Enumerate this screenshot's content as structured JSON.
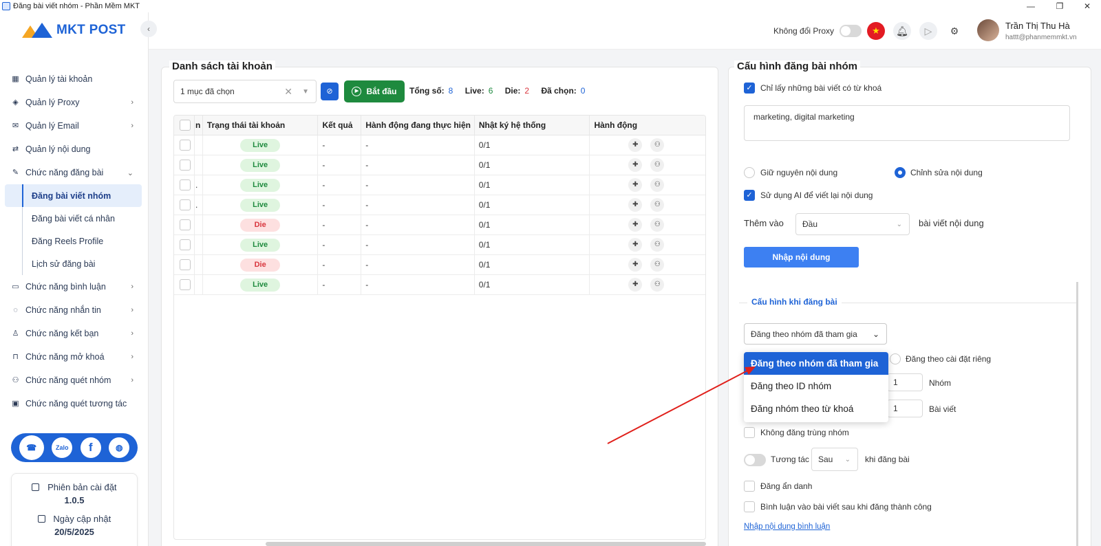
{
  "window": {
    "title": "Đăng bài viết nhóm - Phần Mềm MKT"
  },
  "brand": {
    "logo_text": "MKT POST"
  },
  "sidebar": {
    "items": [
      {
        "label": "Quản lý tài khoản",
        "icon": "grid-icon",
        "has_children": false
      },
      {
        "label": "Quản lý Proxy",
        "icon": "layers-icon",
        "has_children": true
      },
      {
        "label": "Quản lý Email",
        "icon": "mail-icon",
        "has_children": true
      },
      {
        "label": "Quản lý nội dung",
        "icon": "share-icon",
        "has_children": false
      },
      {
        "label": "Chức năng đăng bài",
        "icon": "edit-icon",
        "has_children": true,
        "expanded": true
      }
    ],
    "sub_items": [
      "Đăng bài viết nhóm",
      "Đăng bài viết cá nhân",
      "Đăng Reels Profile",
      "Lịch sử đăng bài"
    ],
    "items_after": [
      {
        "label": "Chức năng bình luận",
        "icon": "comment-icon"
      },
      {
        "label": "Chức năng nhắn tin",
        "icon": "chat-icon"
      },
      {
        "label": "Chức năng kết bạn",
        "icon": "user-plus-icon"
      },
      {
        "label": "Chức năng mở khoá",
        "icon": "lock-icon"
      },
      {
        "label": "Chức năng quét nhóm",
        "icon": "group-icon"
      },
      {
        "label": "Chức năng quét tương tác",
        "icon": "scan-icon",
        "no_chevron": true
      }
    ],
    "social": [
      "support-icon",
      "zalo-icon",
      "facebook-icon",
      "globe-icon"
    ],
    "social_zalo_text": "Zalo",
    "version_label": "Phiên bản cài đặt",
    "version_value": "1.0.5",
    "update_label": "Ngày cập nhật",
    "update_value": "20/5/2025"
  },
  "topbar": {
    "proxy_label": "Không đổi Proxy",
    "user_name": "Trần Thị Thu Hà",
    "user_email": "hattt@phanmemmkt.vn"
  },
  "accounts": {
    "title": "Danh sách tài khoản",
    "select_value": "1 mục đã chọn",
    "start_label": "Bắt đầu",
    "stats": {
      "total_label": "Tổng số:",
      "total": "8",
      "live_label": "Live:",
      "live": "6",
      "die_label": "Die:",
      "die": "2",
      "selected_label": "Đã chọn:",
      "selected": "0"
    },
    "columns": [
      "n",
      "Trạng thái tài khoản",
      "Kết quả",
      "Hành động đang thực hiện",
      "Nhật ký hệ thống",
      "Hành động"
    ],
    "rows": [
      {
        "prefix": "",
        "status": "Live",
        "result": "-",
        "action": "-",
        "log": "0/1"
      },
      {
        "prefix": "",
        "status": "Live",
        "result": "-",
        "action": "-",
        "log": "0/1"
      },
      {
        "prefix": ".",
        "status": "Live",
        "result": "-",
        "action": "-",
        "log": "0/1"
      },
      {
        "prefix": ".",
        "status": "Live",
        "result": "-",
        "action": "-",
        "log": "0/1"
      },
      {
        "prefix": "",
        "status": "Die",
        "result": "-",
        "action": "-",
        "log": "0/1"
      },
      {
        "prefix": "",
        "status": "Live",
        "result": "-",
        "action": "-",
        "log": "0/1"
      },
      {
        "prefix": "",
        "status": "Die",
        "result": "-",
        "action": "-",
        "log": "0/1"
      },
      {
        "prefix": "",
        "status": "Live",
        "result": "-",
        "action": "-",
        "log": "0/1"
      }
    ]
  },
  "config": {
    "title": "Cấu hình đăng bài nhóm",
    "keyword_only_label": "Chỉ lấy những bài viết có từ khoá",
    "keywords": "marketing, digital marketing",
    "keep_content_label": "Giữ nguyên nội dung",
    "edit_content_label": "Chỉnh sửa nội dung",
    "use_ai_label": "Sử dụng AI để viết lại nội dung",
    "add_to_label": "Thêm vào",
    "add_to_value": "Đầu",
    "add_to_suffix": "bài viết nội dung",
    "import_button": "Nhập nội dung",
    "section_label": "Cấu hình khi đăng bài",
    "post_mode_value": "Đăng theo nhóm đã tham gia",
    "post_mode_options": [
      "Đăng theo nhóm đã tham gia",
      "Đăng theo ID nhóm",
      "Đăng nhóm theo từ khoá"
    ],
    "custom_setting_label": "Đăng theo cài đặt riêng",
    "groups_value": "1",
    "groups_unit": "Nhóm",
    "posts_value": "1",
    "posts_unit": "Bài viết",
    "no_duplicate_label": "Không đăng trùng nhóm",
    "interact_label": "Tương tác",
    "interact_when": "Sau",
    "interact_suffix": "khi đăng bài",
    "anonymous_label": "Đăng ẩn danh",
    "comment_label": "Bình luận vào bài viết sau khi đăng thành công",
    "comment_link": "Nhập nội dung bình luận"
  },
  "colors": {
    "primary": "#1e63d6",
    "success": "#1e8a3e",
    "danger": "#d9363e",
    "annotation_arrow": "#e0201b"
  }
}
